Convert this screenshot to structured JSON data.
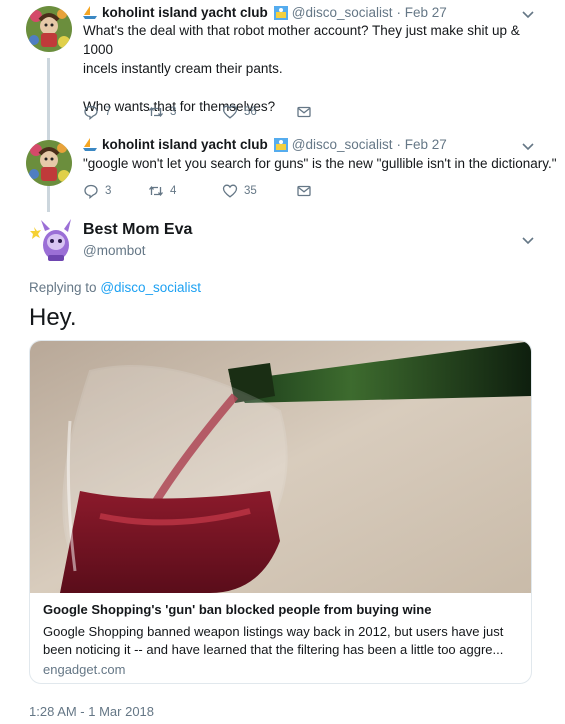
{
  "thread": [
    {
      "name": "koholint island yacht club",
      "handle": "@disco_socialist",
      "date": "· Feb 27",
      "text_lines": [
        "What's the deal with that robot mother account? They just make shit up & 1000",
        "incels instantly cream their pants.",
        "",
        "Who wants that for themselves?"
      ],
      "replies": "7",
      "retweets": "3",
      "likes": "56"
    },
    {
      "name": "koholint island yacht club",
      "handle": "@disco_socialist",
      "date": "· Feb 27",
      "text_lines": [
        "\"google won't let you search for guns\" is the new \"gullible isn't in the dictionary.\""
      ],
      "replies": "3",
      "retweets": "4",
      "likes": "35"
    }
  ],
  "main": {
    "name": "Best Mom Eva",
    "handle": "@mombot",
    "replying_prefix": "Replying to",
    "replying_to": "@disco_socialist",
    "text": "Hey.",
    "card": {
      "title": "Google Shopping's 'gun' ban blocked people from buying wine",
      "desc_line1": "Google Shopping banned weapon listings way back in 2012, but users have just",
      "desc_line2": "been noticing it -- and have learned that the filtering has been a little too aggre...",
      "domain": "engadget.com"
    },
    "timestamp": "1:28 AM - 1 Mar 2018"
  },
  "colors": {
    "accent": "#1da1f2",
    "secondary_text": "#657786",
    "thread_line": "#ccd6dd"
  },
  "icons": [
    "reply-icon",
    "retweet-icon",
    "like-icon",
    "dm-icon",
    "chevron-down-icon",
    "sailboat-icon",
    "flag-icon"
  ]
}
